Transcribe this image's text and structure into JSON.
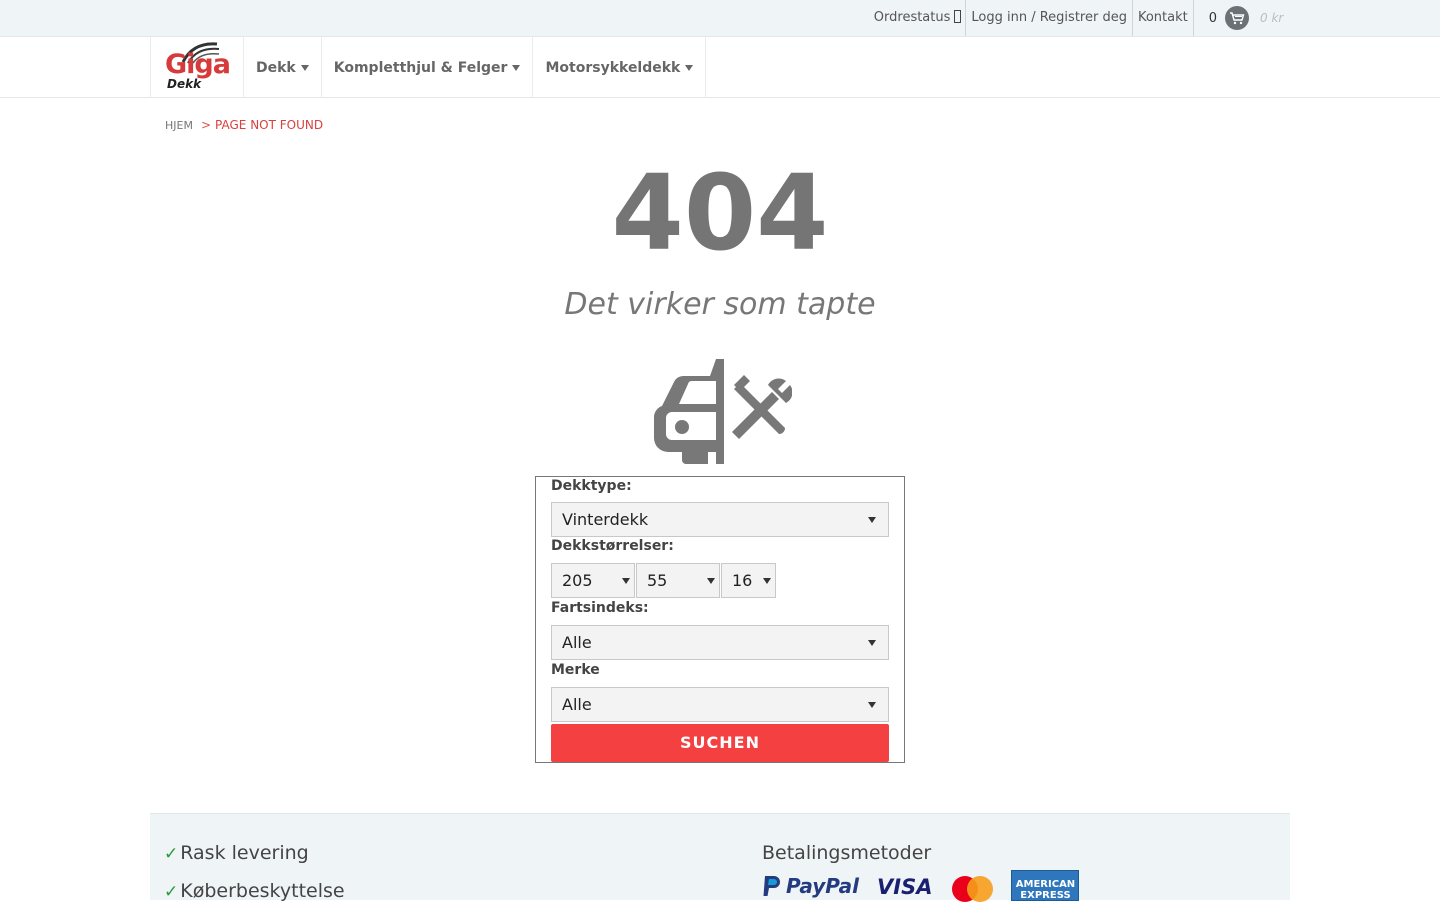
{
  "topbar": {
    "order_status": "Ordrestatus",
    "login": "Logg inn / Registrer deg",
    "contact": "Kontakt",
    "cart_count": "0",
    "cart_total": "0 kr"
  },
  "nav": {
    "logo_main": "Giga",
    "logo_sub": "Dekk",
    "items": [
      {
        "label": "Dekk"
      },
      {
        "label": "Kompletthjul & Felger"
      },
      {
        "label": "Motorsykkeldekk"
      }
    ]
  },
  "breadcrumb": {
    "home": "Hjem",
    "separator": ">",
    "current": "Page not found"
  },
  "error": {
    "code": "404",
    "message": "Det virker som tapte"
  },
  "search_form": {
    "tyre_type_label": "Dekktype:",
    "tyre_type_value": "Vinterdekk",
    "sizes_label": "Dekkstørrelser:",
    "width_value": "205",
    "profile_value": "55",
    "rim_value": "16",
    "speed_label": "Fartsindeks:",
    "speed_value": "Alle",
    "brand_label": "Merke",
    "brand_value": "Alle",
    "submit_label": "SUCHEN"
  },
  "footer": {
    "features": [
      "Rask levering",
      "Køberbeskyttelse"
    ],
    "payment_title": "Betalingsmetoder",
    "payment_logos": {
      "paypal": "PayPal",
      "visa": "VISA",
      "amex_line1": "AMERICAN",
      "amex_line2": "EXPRESS"
    }
  },
  "colors": {
    "accent": "#f44040",
    "breadcrumb_active": "#d9403e",
    "topbar_bg": "#eff4f7"
  }
}
